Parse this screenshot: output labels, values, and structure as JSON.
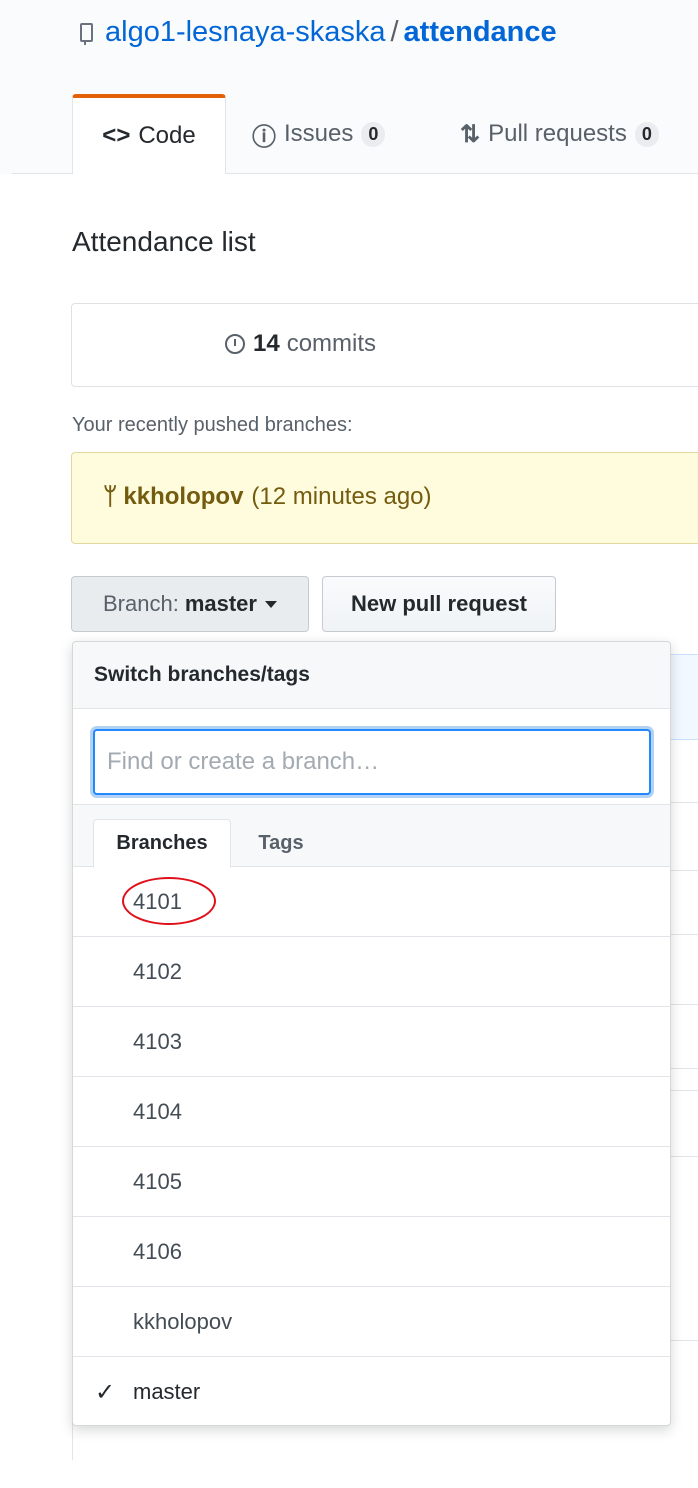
{
  "repo": {
    "owner": "algo1-lesnaya-skaska",
    "separator": "/",
    "name": "attendance"
  },
  "tabs": [
    {
      "icon": "<>",
      "label": "Code"
    },
    {
      "icon": "ⓘ",
      "label": "Issues",
      "count": "0"
    },
    {
      "icon": "⇅",
      "label": "Pull requests",
      "count": "0"
    }
  ],
  "about": "Attendance list",
  "summary": {
    "commits_count": "14",
    "commits_label": "commits"
  },
  "recent": {
    "label": "Your recently pushed branches:",
    "branch": "kkholopov",
    "time": "(12 minutes ago)"
  },
  "buttons": {
    "branch_prefix": "Branch:",
    "branch_current": "master",
    "new_pr": "New pull request"
  },
  "dropdown": {
    "title": "Switch branches/tags",
    "filter_placeholder": "Find or create a branch…",
    "tabs": [
      "Branches",
      "Tags"
    ],
    "branches": [
      {
        "name": "4101",
        "selected": false,
        "circled": true
      },
      {
        "name": "4102",
        "selected": false
      },
      {
        "name": "4103",
        "selected": false
      },
      {
        "name": "4104",
        "selected": false
      },
      {
        "name": "4105",
        "selected": false
      },
      {
        "name": "4106",
        "selected": false
      },
      {
        "name": "kkholopov",
        "selected": false
      },
      {
        "name": "master",
        "selected": true
      }
    ],
    "check_icon": "✓"
  },
  "colors": {
    "link": "#0366d6",
    "accent_tab": "#e36209",
    "recent_bg": "#fffbdd",
    "annotation": "#e0101a"
  }
}
